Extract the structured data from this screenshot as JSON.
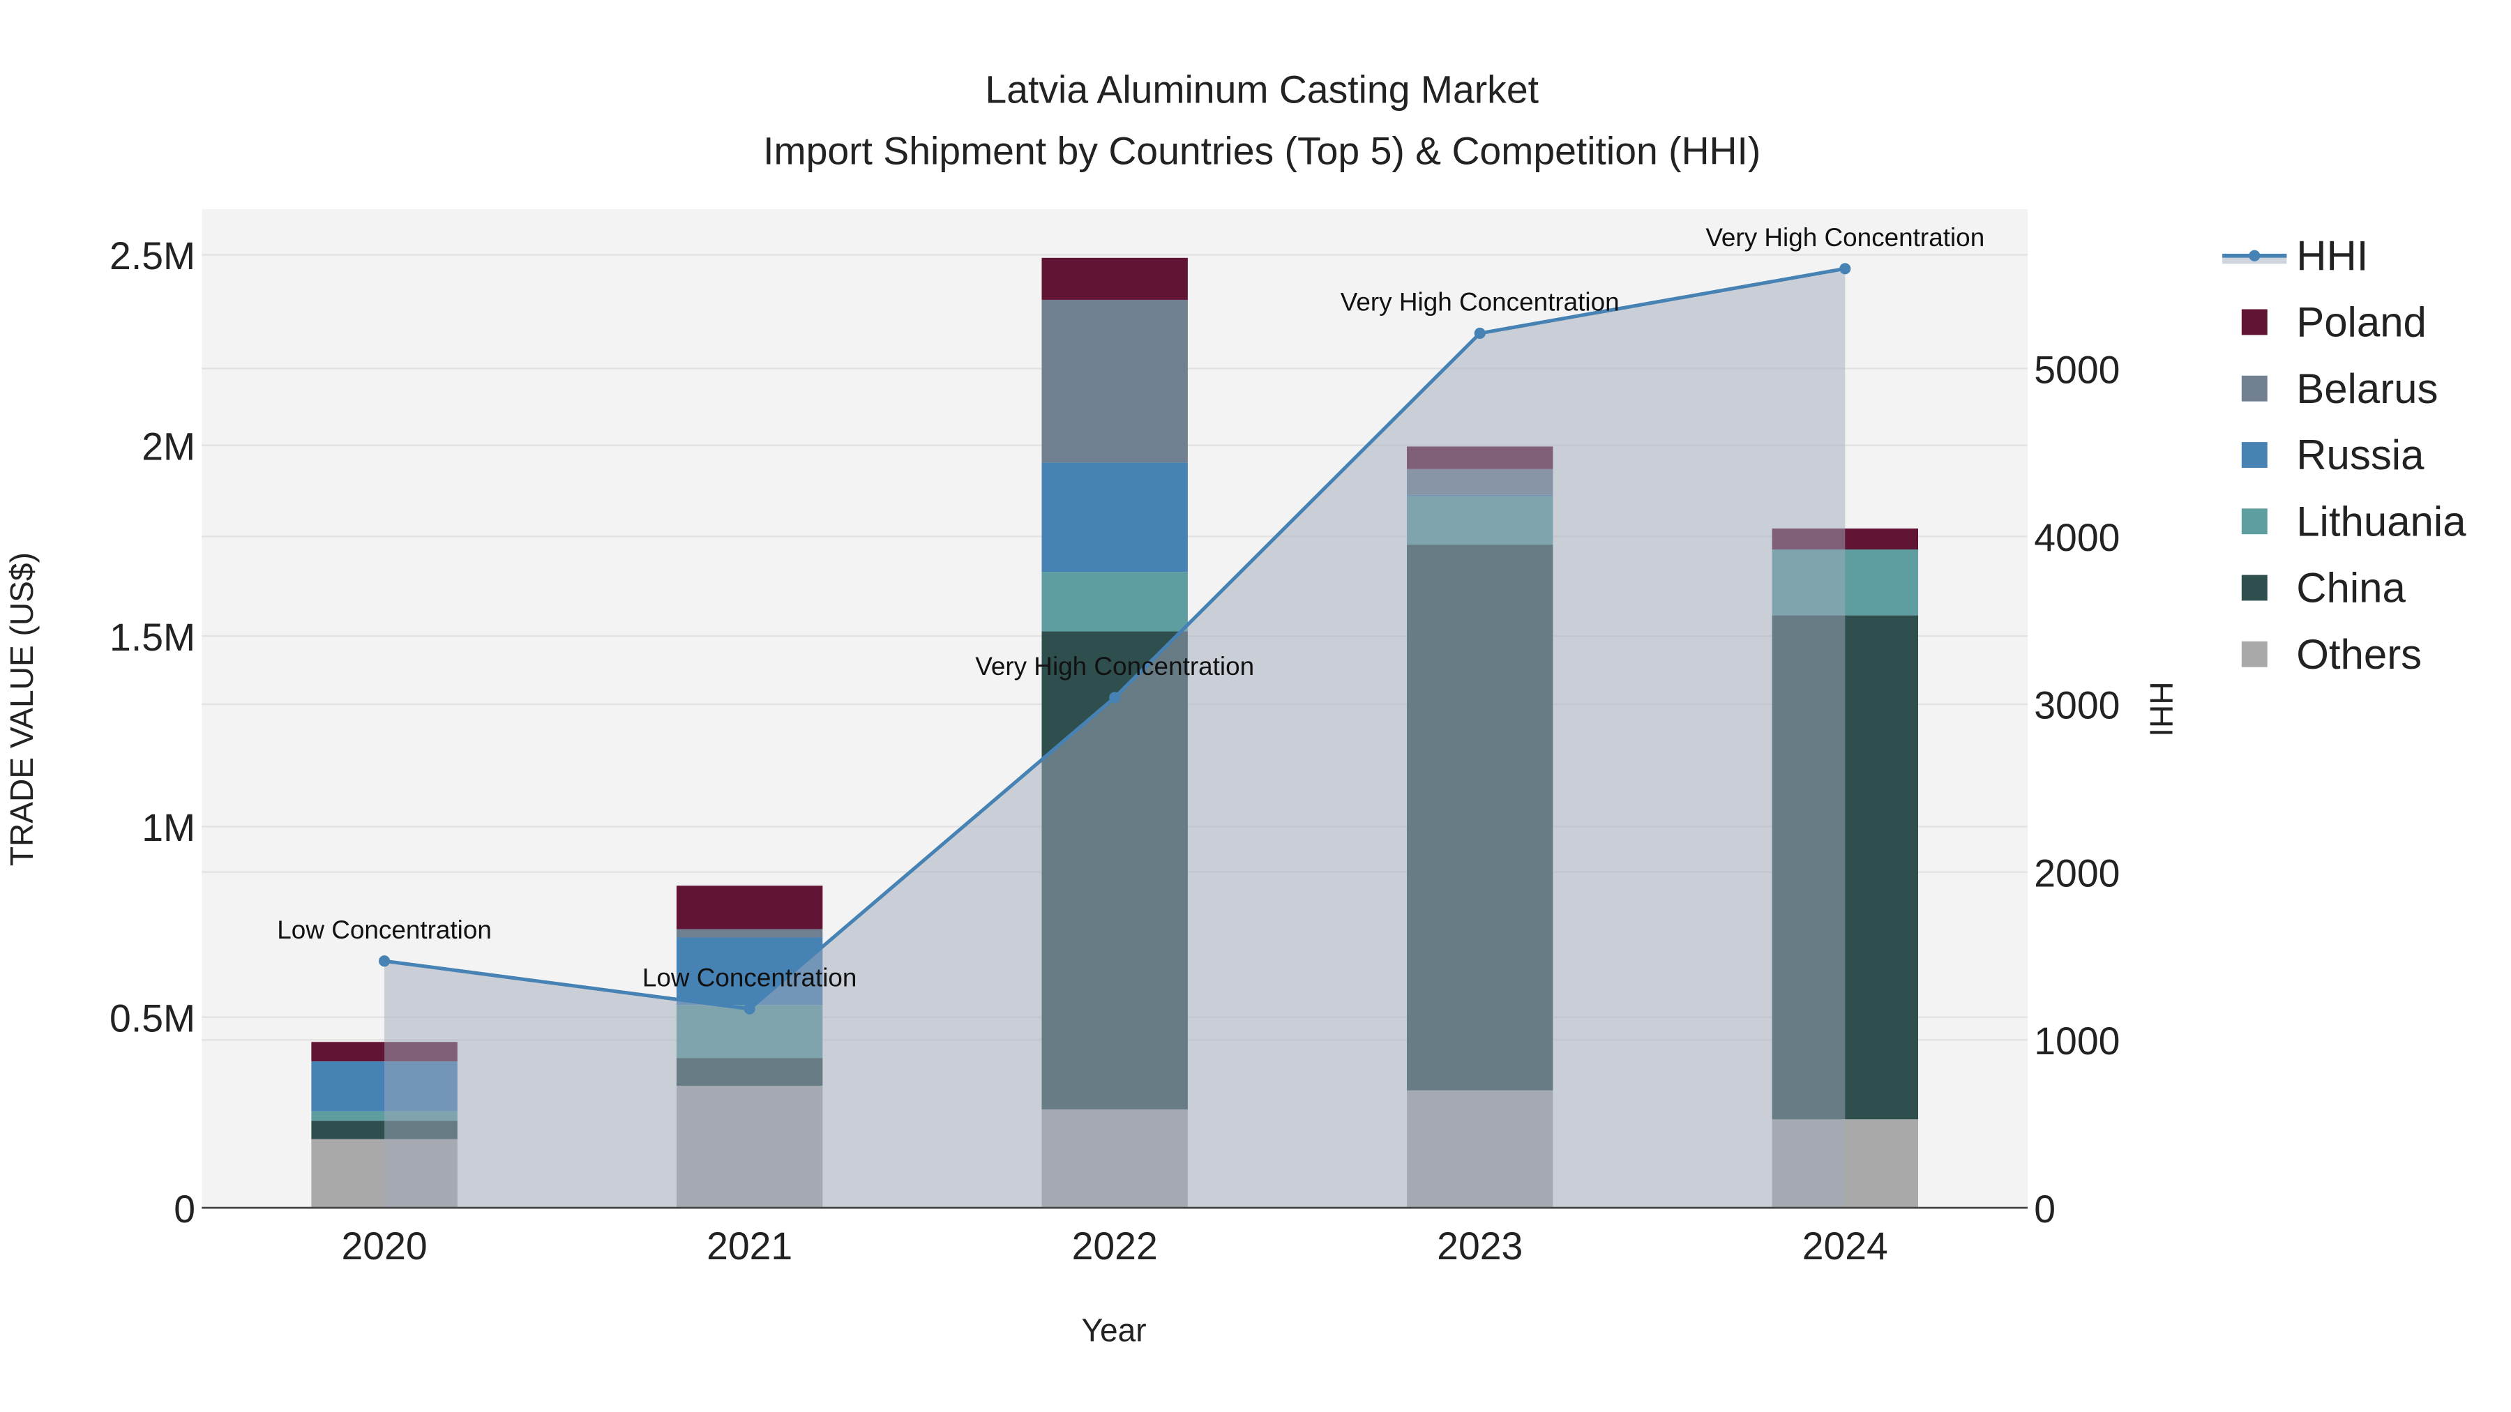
{
  "chart_data": {
    "type": "bar",
    "title_line1": "Latvia Aluminum Casting Market",
    "title_line2": "Import Shipment by Countries (Top 5) & Competition (HHI)",
    "xlabel": "Year",
    "ylabel": "TRADE VALUE (US$)",
    "y2label": "HHI",
    "categories": [
      "2020",
      "2021",
      "2022",
      "2023",
      "2024"
    ],
    "ylim": [
      0,
      2620000
    ],
    "y2lim": [
      0,
      5950
    ],
    "yticks": [
      {
        "v": 0,
        "label": "0"
      },
      {
        "v": 500000,
        "label": "0.5M"
      },
      {
        "v": 1000000,
        "label": "1M"
      },
      {
        "v": 1500000,
        "label": "1.5M"
      },
      {
        "v": 2000000,
        "label": "2M"
      },
      {
        "v": 2500000,
        "label": "2.5M"
      }
    ],
    "y2ticks": [
      {
        "v": 0,
        "label": "0"
      },
      {
        "v": 1000,
        "label": "1000"
      },
      {
        "v": 2000,
        "label": "2000"
      },
      {
        "v": 3000,
        "label": "3000"
      },
      {
        "v": 4000,
        "label": "4000"
      },
      {
        "v": 5000,
        "label": "5000"
      }
    ],
    "grid": true,
    "legend_position": "right",
    "series": [
      {
        "name": "Others",
        "color": "#a9a9a9",
        "values": [
          180000,
          320000,
          258000,
          308000,
          232000
        ]
      },
      {
        "name": "China",
        "color": "#2f4f4f",
        "values": [
          48000,
          73000,
          1254000,
          1432000,
          1322000
        ]
      },
      {
        "name": "Lithuania",
        "color": "#5f9ea0",
        "values": [
          25000,
          139000,
          156000,
          127000,
          173000
        ]
      },
      {
        "name": "Russia",
        "color": "#4682b4",
        "values": [
          131000,
          177000,
          287000,
          3000,
          0
        ]
      },
      {
        "name": "Belarus",
        "color": "#708090",
        "values": [
          0,
          22000,
          427000,
          68000,
          0
        ]
      },
      {
        "name": "Poland",
        "color": "#611434",
        "values": [
          51000,
          114000,
          110000,
          59000,
          55000
        ]
      }
    ],
    "hhi": {
      "name": "HHI",
      "color": "#4682b4",
      "values": [
        1470,
        1185,
        3040,
        5210,
        5595
      ],
      "annotations": [
        "Low Concentration",
        "Low Concentration",
        "Very High Concentration",
        "Very High Concentration",
        "Very High Concentration"
      ]
    },
    "legend_order": [
      "HHI",
      "Poland",
      "Belarus",
      "Russia",
      "Lithuania",
      "China",
      "Others"
    ]
  }
}
